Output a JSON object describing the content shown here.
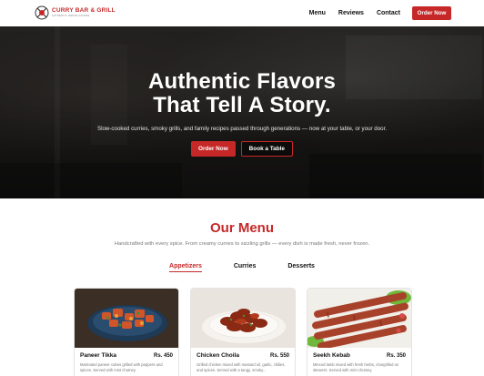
{
  "brand": {
    "name": "CURRY BAR & GRILL",
    "tagline": "AUTHENTIC INDIAN CUISINE",
    "color": "#c62828"
  },
  "nav": {
    "links": [
      "Menu",
      "Reviews",
      "Contact"
    ],
    "cta": "Order Now"
  },
  "hero": {
    "title_line1": "Authentic Flavors",
    "title_line2": "That Tell A Story.",
    "subtitle": "Slow-cooked curries, smoky grills, and family recipes passed through generations — now at your table, or your door.",
    "primary_button": "Order Now",
    "secondary_button": "Book a Table"
  },
  "menu": {
    "title": "Our Menu",
    "subtitle": "Handcrafted with every spice. From creamy curries to sizzling grills — every dish is made fresh, never frozen.",
    "tabs": [
      "Appetizers",
      "Curries",
      "Desserts"
    ],
    "active_tab": "Appetizers",
    "items": [
      {
        "name": "Paneer Tikka",
        "price": "Rs. 450",
        "desc": "Marinated paneer cubes grilled with peppers and spices. Served with mint chutney."
      },
      {
        "name": "Chicken Choila",
        "price": "Rs. 550",
        "desc": "Grilled chicken mixed with mustard oil, garlic, chilies, and spices. Served with a tangy, smoky..."
      },
      {
        "name": "Seekh Kebab",
        "price": "Rs. 350",
        "desc": "Minced lamb mixed with fresh herbs, chargrilled on skewers. Served with mint chutney."
      }
    ]
  }
}
